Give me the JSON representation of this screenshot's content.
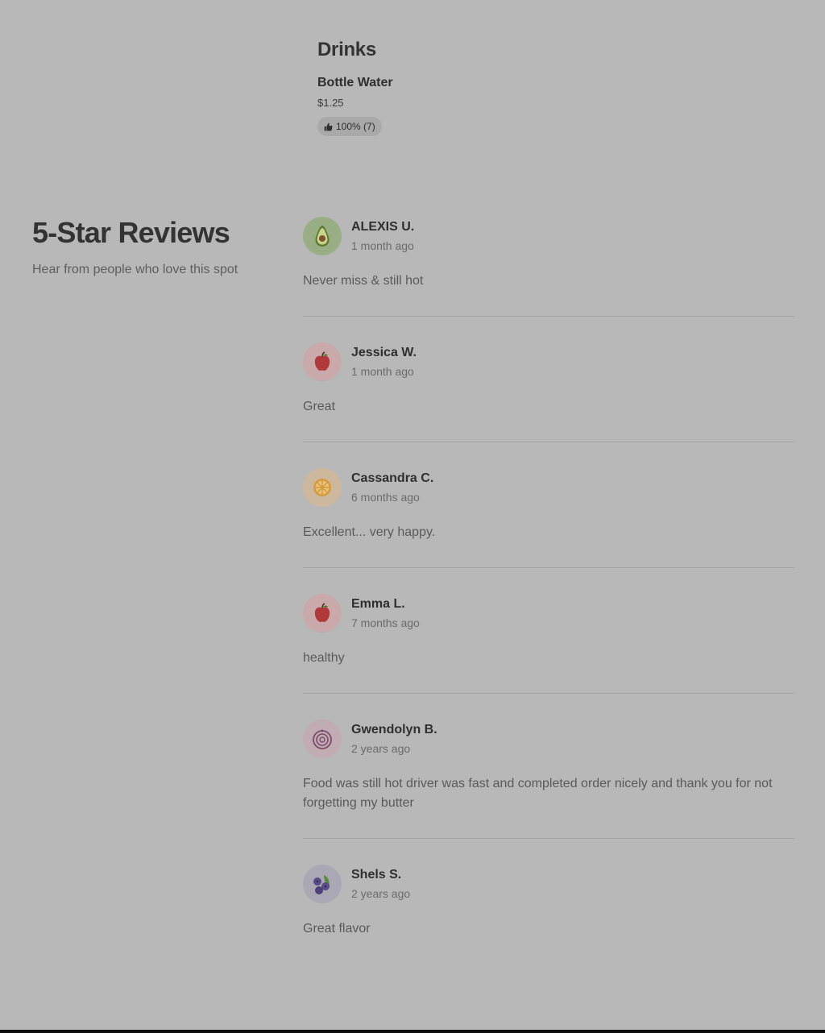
{
  "drinks": {
    "heading": "Drinks",
    "item": {
      "name": "Bottle Water",
      "price": "$1.25",
      "rating": "100% (7)"
    }
  },
  "reviews_section": {
    "title": "5-Star Reviews",
    "subtitle": "Hear from people who love this spot"
  },
  "reviews": [
    {
      "name": "ALEXIS U.",
      "date": "1 month ago",
      "text": "Never miss & still hot",
      "avatar_icon": "avocado-icon",
      "avatar_bg": "#9aae86"
    },
    {
      "name": "Jessica W.",
      "date": "1 month ago",
      "text": "Great",
      "avatar_icon": "apple-icon",
      "avatar_bg": "#c9a9a9"
    },
    {
      "name": "Cassandra C.",
      "date": "6 months ago",
      "text": "Excellent... very happy.",
      "avatar_icon": "orange-slice-icon",
      "avatar_bg": "#cdb89e"
    },
    {
      "name": "Emma L.",
      "date": "7 months ago",
      "text": "healthy",
      "avatar_icon": "apple-icon",
      "avatar_bg": "#c9a9a9"
    },
    {
      "name": "Gwendolyn B.",
      "date": "2 years ago",
      "text": "Food was still hot driver was fast and completed order nicely and thank you for not forgetting my butter",
      "avatar_icon": "onion-icon",
      "avatar_bg": "#c2acb4"
    },
    {
      "name": "Shels S.",
      "date": "2 years ago",
      "text": "Great flavor",
      "avatar_icon": "blueberries-icon",
      "avatar_bg": "#a9a8b4"
    }
  ]
}
